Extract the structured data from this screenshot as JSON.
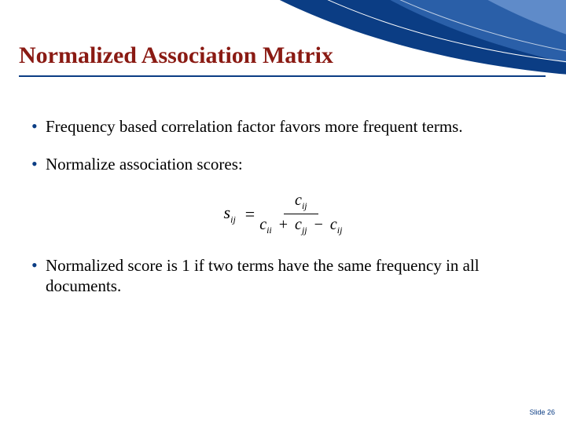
{
  "title": "Normalized Association Matrix",
  "bullets": {
    "b1": "Frequency based correlation factor favors more frequent terms.",
    "b2": "Normalize association scores:",
    "b3": "Normalized score is 1 if two terms have the same frequency in all documents."
  },
  "formula": {
    "lhs_var": "s",
    "lhs_sub": "ij",
    "num_var": "c",
    "num_sub": "ij",
    "den_t1_var": "c",
    "den_t1_sub": "ii",
    "den_t2_var": "c",
    "den_t2_sub": "jj",
    "den_t3_var": "c",
    "den_t3_sub": "ij"
  },
  "footer": "Slide 26"
}
